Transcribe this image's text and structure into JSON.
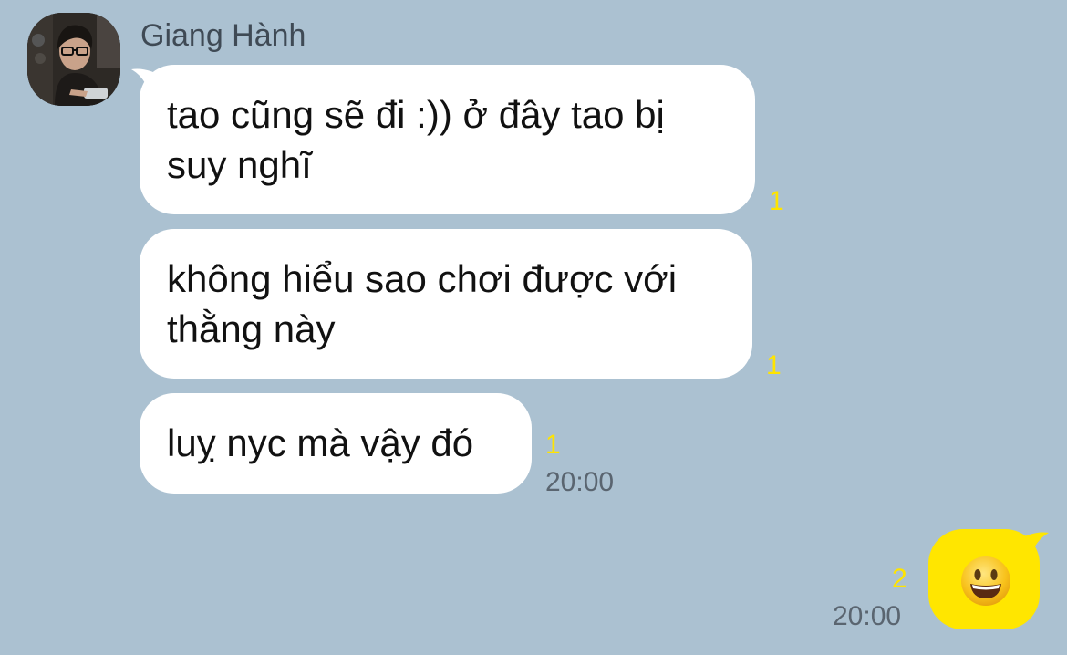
{
  "sender": {
    "name": "Giang Hành"
  },
  "incoming_messages": [
    {
      "text": "tao cũng sẽ đi :)) ở đây tao bị suy nghĩ",
      "read_count": "1"
    },
    {
      "text": "không hiểu sao chơi được với thằng này",
      "read_count": "1"
    },
    {
      "text": "luỵ nyc mà vậy đó",
      "read_count": "1",
      "time": "20:00"
    }
  ],
  "outgoing_messages": [
    {
      "icon": "grinning-face-emoji-icon",
      "read_count": "2",
      "time": "20:00"
    }
  ],
  "colors": {
    "background": "#abc1d1",
    "incoming_bubble": "#ffffff",
    "outgoing_bubble": "#ffe600",
    "read_count": "#ffe400",
    "timestamp": "#5a6570"
  }
}
